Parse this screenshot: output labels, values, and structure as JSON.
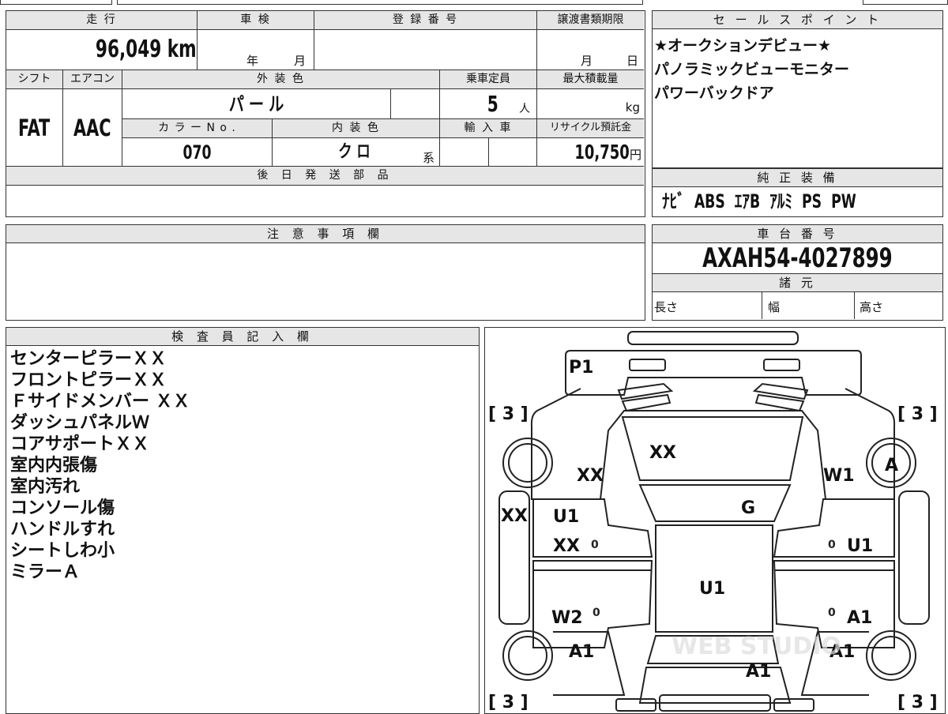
{
  "vehicle": {
    "mileage_label": "走 行",
    "mileage": "96,049 km",
    "shaken_label": "車 検",
    "shaken_year": "年",
    "shaken_month": "月",
    "reg_label": "登 録 番 号",
    "transfer_label": "譲渡書類期限",
    "transfer_month": "月",
    "transfer_day": "日",
    "shift_label": "シフト",
    "shift": "FAT",
    "ac_label": "エアコン",
    "ac": "AAC",
    "color_label": "外 装 色",
    "color": "パ ー ル",
    "capacity_label": "乗車定員",
    "capacity": "5",
    "capacity_unit": "人",
    "load_label": "最大積載量",
    "load_unit": "kg",
    "color_no_label": "カ ラ ー  N o .",
    "color_no": "070",
    "interior_label": "内 装 色",
    "interior": "ク ロ",
    "interior_unit": "系",
    "import_label": "輸 入 車",
    "recycle_label": "リサイクル預託金",
    "recycle": "10,750",
    "recycle_unit": "円",
    "later_parts_label": "後 日 発 送 部 品"
  },
  "sales": {
    "label": "セ ー ル ス ポ イ ン ト",
    "lines": [
      "★オークションデビュー★",
      "パノラミックビューモニター",
      "パワーバックドア"
    ]
  },
  "equipment": {
    "label": "純 正 装 備",
    "value": "ﾅﾋﾞ  ABS  ｴｱB  ｱﾙﾐ  PS  PW"
  },
  "notes": {
    "label": "注 意 事 項 欄"
  },
  "chassis": {
    "label": "車 台 番 号",
    "value": "AXAH54-4027899"
  },
  "specs": {
    "label": "諸 元",
    "length": "長さ",
    "width": "幅",
    "height": "高さ"
  },
  "inspector": {
    "label": "検 査 員 記 入 欄",
    "lines": [
      "センターピラーＸＸ",
      "フロントピラーＸＸ",
      "Ｆサイドメンバー ＸＸ",
      "ダッシュパネルＷ",
      "コアサポートＸＸ",
      "室内内張傷",
      "室内汚れ",
      "コンソール傷",
      "ハンドルすれ",
      "シートしわ小",
      "ミラーＡ"
    ]
  },
  "diagram": {
    "p1": "P1",
    "tire_fl": "[ 3 ]",
    "tire_fr": "[ 3 ]",
    "tire_rl": "[ 3 ]",
    "tire_rr": "[ 3 ]",
    "hood": "XX",
    "front_left": "XX",
    "front_right": "W1",
    "right_mirror": "A",
    "left_pillar": "XX",
    "windshield": "G",
    "left_front_door_1": "U1",
    "left_front_door_2": "XX",
    "right_front_door": "U1",
    "roof": "U1",
    "left_rear_door": "W2",
    "right_rear_door": "A1",
    "left_rear_quarter": "A1",
    "right_rear_quarter": "A1",
    "trunk": "A1",
    "zero": "0",
    "watermark": "WEB STUDIO"
  }
}
